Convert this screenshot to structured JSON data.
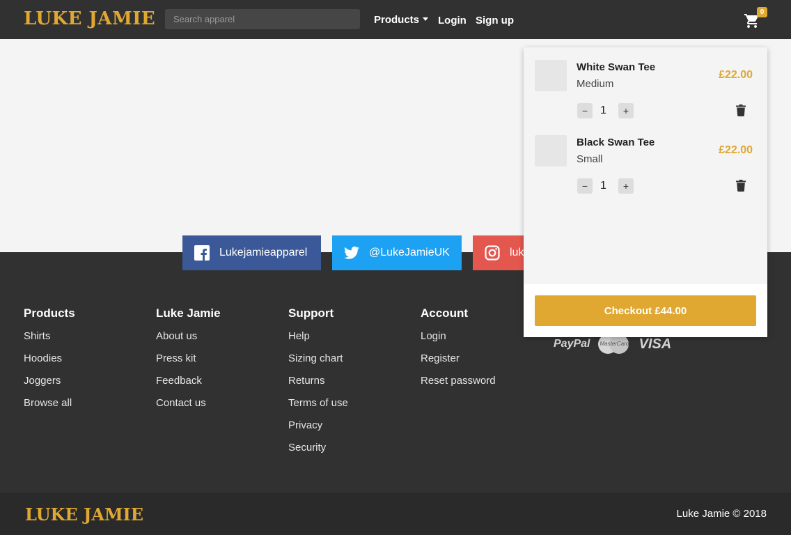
{
  "header": {
    "logo": "LUKE JAMIE",
    "search_placeholder": "Search apparel",
    "nav": {
      "products": "Products",
      "login": "Login",
      "signup": "Sign up"
    },
    "cart_count": "0"
  },
  "social": {
    "facebook": "Lukejamieapparel",
    "twitter": "@LukeJamieUK",
    "instagram": "luk"
  },
  "cart": {
    "items": [
      {
        "name": "White Swan Tee",
        "variant": "Medium",
        "price": "£22.00",
        "qty": "1"
      },
      {
        "name": "Black Swan Tee",
        "variant": "Small",
        "price": "£22.00",
        "qty": "1"
      }
    ],
    "checkout_label": "Checkout £44.00",
    "minus": "−",
    "plus": "+"
  },
  "footer": {
    "columns": [
      {
        "title": "Products",
        "links": [
          "Shirts",
          "Hoodies",
          "Joggers",
          "Browse all"
        ]
      },
      {
        "title": "Luke Jamie",
        "links": [
          "About us",
          "Press kit",
          "Feedback",
          "Contact us"
        ]
      },
      {
        "title": "Support",
        "links": [
          "Help",
          "Sizing chart",
          "Returns",
          "Terms of use",
          "Privacy",
          "Security"
        ]
      },
      {
        "title": "Account",
        "links": [
          "Login",
          "Register",
          "Reset password"
        ]
      }
    ],
    "payments": {
      "paypal": "PayPal",
      "mastercard": "MasterCard",
      "visa": "VISA"
    }
  },
  "bottom": {
    "logo": "LUKE JAMIE",
    "copyright": "Luke Jamie © 2018"
  },
  "colors": {
    "accent": "#e0a731",
    "dark": "#313131",
    "facebook": "#3b5998",
    "twitter": "#1da1f2",
    "instagram": "#e4574f"
  }
}
